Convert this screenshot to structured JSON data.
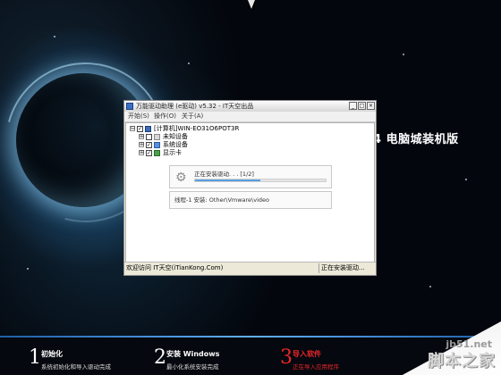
{
  "desktop": {
    "brand_text": "4  电脑城装机版"
  },
  "window": {
    "title": "万能驱动助理 (e驱动) v5.32 - IT天空出品",
    "controls": {
      "minimize": "_",
      "maximize": "□",
      "close": "×"
    },
    "menu": [
      "开始(S)",
      "操作(O)",
      "关于(A)"
    ],
    "tree": [
      {
        "label": "[计算机]WIN-EO31O6POT3R",
        "expander": "⊟",
        "checked": true
      },
      {
        "label": "未知设备",
        "expander": "⊞",
        "checked": false
      },
      {
        "label": "系统设备",
        "expander": "⊞",
        "checked": true
      },
      {
        "label": "显示卡",
        "expander": "⊞",
        "checked": true
      }
    ],
    "progress": {
      "label": "正在安装驱动. . . [1/2]",
      "fraction": 0.5
    },
    "status_detail": "线程-1 安装:   Other\\Vmware\\video",
    "statusbar": {
      "left": "欢迎访问 IT天空(iTianKong.Com)",
      "right": "正在安装驱动..."
    }
  },
  "steps": [
    {
      "num": "1",
      "title": "初始化",
      "desc": "系统初始化和导入驱动完成",
      "active": false
    },
    {
      "num": "2",
      "title": "安装 Windows",
      "desc": "最小化系统安装完成",
      "active": false
    },
    {
      "num": "3",
      "title": "导入软件",
      "desc": "正在导入应用程序",
      "active": true
    }
  ],
  "watermark": {
    "url": "jb51.net",
    "cn": "脚本之家"
  },
  "colors": {
    "active_step": "#e8262a",
    "progress_fill": "#3e88d4",
    "window_face": "#ece9d8"
  }
}
